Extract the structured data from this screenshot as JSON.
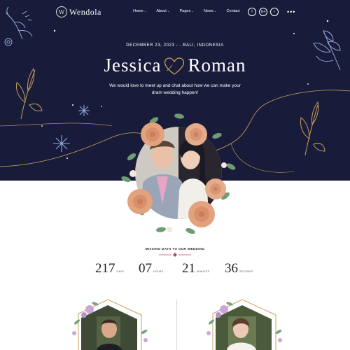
{
  "brand": {
    "logo_initial": "W",
    "name": "Wendola"
  },
  "nav": {
    "items": [
      {
        "label": "Home",
        "has_dropdown": true
      },
      {
        "label": "About",
        "has_dropdown": true
      },
      {
        "label": "Pages",
        "has_dropdown": true
      },
      {
        "label": "News",
        "has_dropdown": true
      },
      {
        "label": "Contact",
        "has_dropdown": false
      }
    ],
    "dropdown_glyph": "⌄",
    "social": [
      {
        "icon": "facebook-icon",
        "glyph": "f"
      },
      {
        "icon": "google-plus-icon",
        "glyph": "G+"
      },
      {
        "icon": "twitter-icon",
        "glyph": "t"
      }
    ],
    "more_glyph": "•••"
  },
  "hero": {
    "date_location": "DECEMBER 23, 2023 - - BALI, INDONESIA",
    "groom_name": "Jessica",
    "bride_name": "Roman",
    "intro": "We would love to meet up and chat about how we can make your dram wedding happen!"
  },
  "countdown": {
    "title": "MISSING DAYS TO OUR WEDDING",
    "items": [
      {
        "value": "217",
        "unit": "DAYS"
      },
      {
        "value": "07",
        "unit": "HOURS"
      },
      {
        "value": "21",
        "unit": "MINUTES"
      },
      {
        "value": "36",
        "unit": "SECONDS"
      }
    ]
  },
  "colors": {
    "hero_bg": "#181c3a",
    "gold": "#c9a15a",
    "accent_pink": "#b4476d",
    "text_dark": "#222222"
  }
}
